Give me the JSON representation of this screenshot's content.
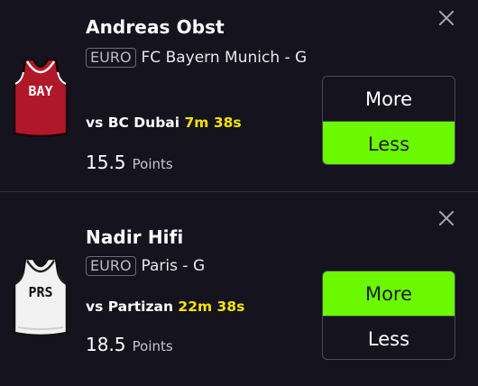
{
  "picks": [
    {
      "player": "Andreas Obst",
      "league": "EURO",
      "team_position": "FC Bayern Munich - G",
      "matchup_prefix": "vs BC Dubai",
      "timer": "7m 38s",
      "line_value": "15.5",
      "line_unit": "Points",
      "jersey_text": "BAY",
      "jersey_color": "#b0182a",
      "more_label": "More",
      "less_label": "Less",
      "selected": "less"
    },
    {
      "player": "Nadir Hifi",
      "league": "EURO",
      "team_position": "Paris - G",
      "matchup_prefix": "vs Partizan",
      "timer": "22m 38s",
      "line_value": "18.5",
      "line_unit": "Points",
      "jersey_text": "PRS",
      "jersey_color": "#f2f2f2",
      "more_label": "More",
      "less_label": "Less",
      "selected": "more"
    }
  ],
  "colors": {
    "background": "#14131e",
    "selected": "#6bf900",
    "timer": "#f5e400"
  }
}
